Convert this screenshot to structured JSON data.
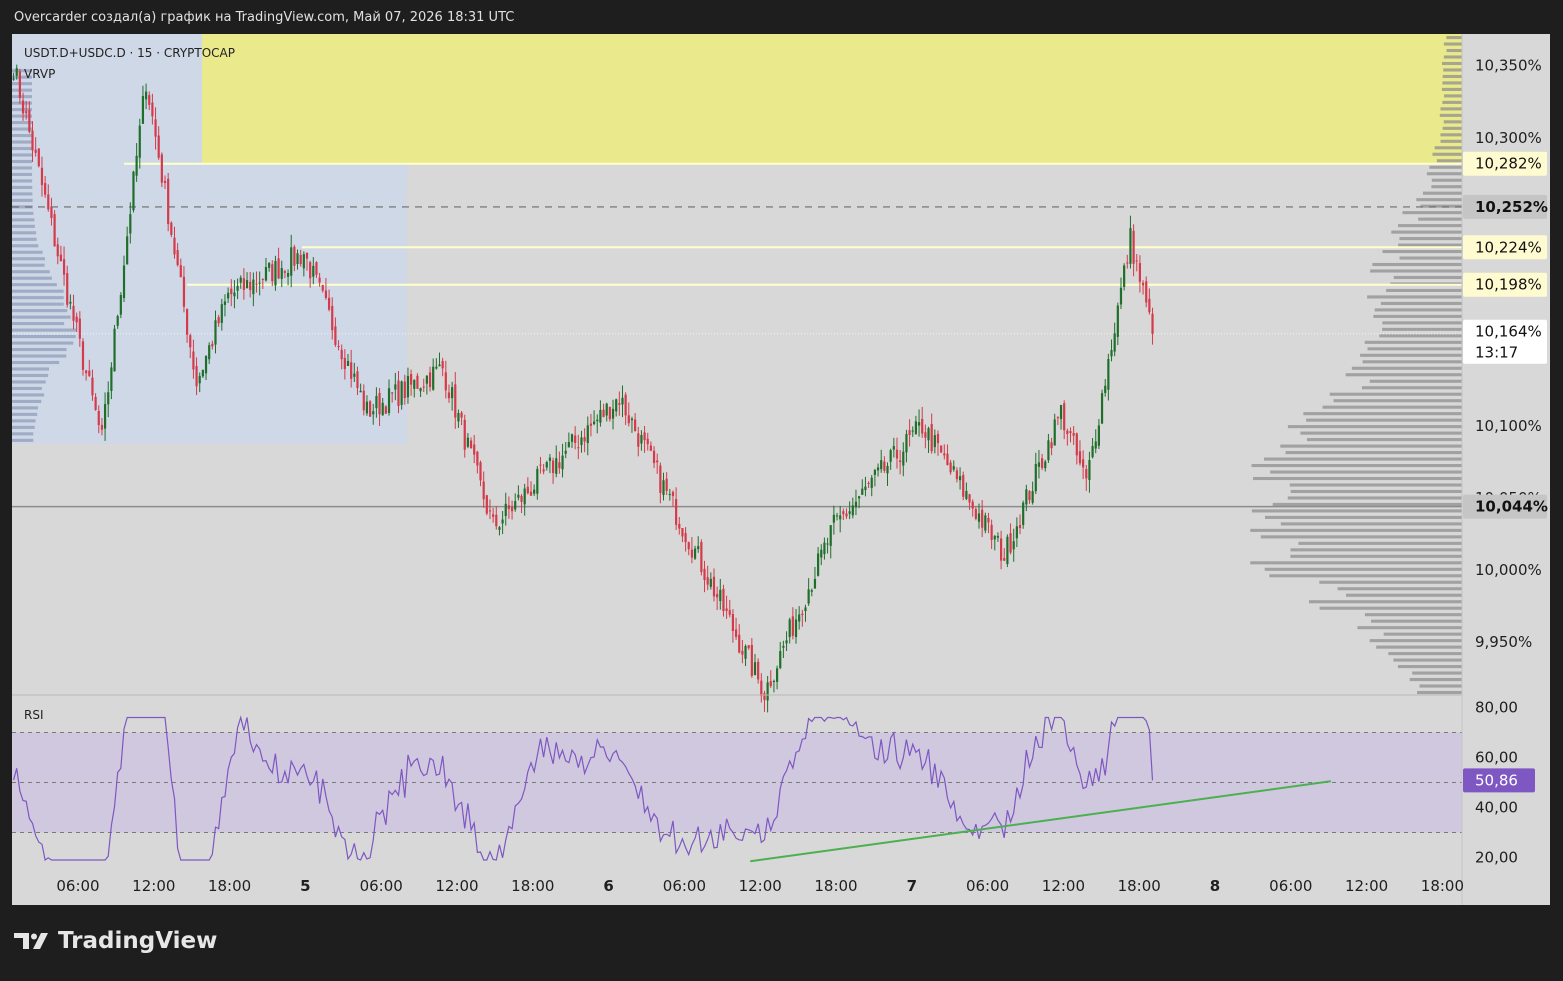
{
  "header": {
    "text": "Overcarder создал(а) график на TradingView.com, Май 07, 2026 18:31 UTC"
  },
  "brand": {
    "name": "TradingView"
  },
  "legend": {
    "symbol": "USDT.D+USDC.D · 15 · CRYPTOCAP",
    "indicator": "VRVP"
  },
  "rsi_panel": {
    "title": "RSI",
    "value_label": "50,86"
  },
  "colors": {
    "up": "#1f6f2b",
    "down": "#d43a4a",
    "rsi_line": "#7e57c2",
    "rsi_band": "#cfc6df",
    "trendline": "#4caf50",
    "yellow_zone": "#eaea8c",
    "price_tag_yellow": "#fffbd1",
    "price_tag_gray": "#c5c5c5",
    "rsi_tag": "#7e57c2",
    "volume_profile": "#8f8f8f"
  },
  "chart_data": {
    "type": "candlestick",
    "title": "USDT.D+USDC.D · 15 · CRYPTOCAP",
    "unit": "%",
    "y_ticks": [
      "10,350%",
      "10,300%",
      "10,100%",
      "10,050%",
      "10,000%",
      "9,950%"
    ],
    "y_tick_values": [
      10.35,
      10.3,
      10.1,
      10.05,
      10.0,
      9.95
    ],
    "ylim": [
      9.914,
      10.372
    ],
    "x_ticks": [
      "06:00",
      "12:00",
      "18:00",
      "5",
      "06:00",
      "12:00",
      "18:00",
      "6",
      "06:00",
      "12:00",
      "18:00",
      "7",
      "06:00",
      "12:00",
      "18:00",
      "8",
      "06:00",
      "12:00",
      "18:00"
    ],
    "price_labels": [
      {
        "text": "10,282%",
        "value": 10.282,
        "style": "yellow"
      },
      {
        "text": "10,252%",
        "value": 10.252,
        "style": "gray"
      },
      {
        "text": "10,224%",
        "value": 10.224,
        "style": "yellow"
      },
      {
        "text": "10,198%",
        "value": 10.198,
        "style": "yellow"
      },
      {
        "text": "10,044%",
        "value": 10.044,
        "style": "gray"
      }
    ],
    "last_price": {
      "text": "10,164%",
      "value": 10.164,
      "countdown": "13:17"
    },
    "dashed_level": 10.252,
    "support_level": 10.044,
    "resistance_zone": [
      10.282,
      10.372
    ],
    "key_points": [
      {
        "x": "4 00:00",
        "y": 10.35
      },
      {
        "x": "4 07:00",
        "y": 10.09
      },
      {
        "x": "4 10:30",
        "y": 10.34
      },
      {
        "x": "4 14:30",
        "y": 10.13
      },
      {
        "x": "4 17:00",
        "y": 10.19
      },
      {
        "x": "4 23:00",
        "y": 10.22
      },
      {
        "x": "5 04:00",
        "y": 10.11
      },
      {
        "x": "5 10:00",
        "y": 10.14
      },
      {
        "x": "5 14:00",
        "y": 10.03
      },
      {
        "x": "6 00:00",
        "y": 10.12
      },
      {
        "x": "6 11:30",
        "y": 9.915
      },
      {
        "x": "6 17:00",
        "y": 10.03
      },
      {
        "x": "7 00:00",
        "y": 10.1
      },
      {
        "x": "7 06:30",
        "y": 10.01
      },
      {
        "x": "7 11:00",
        "y": 10.11
      },
      {
        "x": "7 13:00",
        "y": 10.06
      },
      {
        "x": "7 16:30",
        "y": 10.23
      },
      {
        "x": "7 18:15",
        "y": 10.164
      }
    ],
    "rsi": {
      "y_ticks": [
        "80,00",
        "60,00",
        "40,00",
        "20,00"
      ],
      "y_tick_values": [
        80,
        60,
        40,
        20
      ],
      "ylim": [
        15,
        85
      ],
      "levels": [
        70,
        50,
        30
      ],
      "last": 50.86,
      "trendline": [
        {
          "x": "6 10:30",
          "y": 18.5
        },
        {
          "x": "8 08:30",
          "y": 50.5
        }
      ]
    }
  }
}
